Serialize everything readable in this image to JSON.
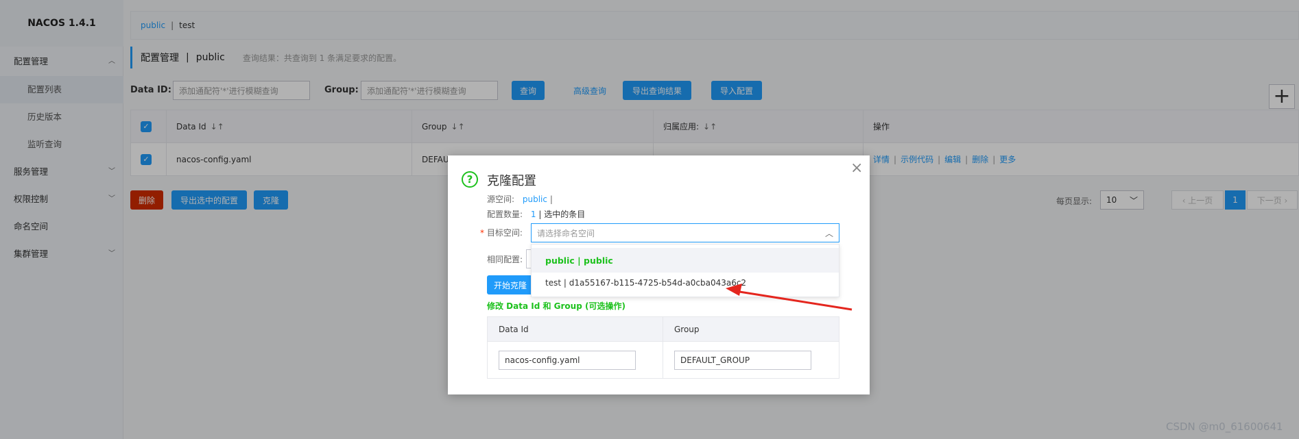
{
  "sidebar": {
    "logo": "NACOS 1.4.1",
    "items": [
      {
        "label": "配置管理",
        "chevron": "︿"
      },
      {
        "label": "配置列表"
      },
      {
        "label": "历史版本"
      },
      {
        "label": "监听查询"
      },
      {
        "label": "服务管理",
        "chevron": "﹀"
      },
      {
        "label": "权限控制",
        "chevron": "﹀"
      },
      {
        "label": "命名空间"
      },
      {
        "label": "集群管理",
        "chevron": "﹀"
      }
    ]
  },
  "namespace_tabs": {
    "public": "public",
    "separator": "|",
    "test": "test"
  },
  "page_title": {
    "section": "配置管理",
    "pipe": "|",
    "namespace": "public",
    "result": "查询结果：共查询到 1 条满足要求的配置。"
  },
  "filters": {
    "dataid_label": "Data ID:",
    "dataid_placeholder": "添加通配符'*'进行模糊查询",
    "group_label": "Group:",
    "group_placeholder": "添加通配符'*'进行模糊查询",
    "query_btn": "查询",
    "advanced_link": "高级查询",
    "export_btn": "导出查询结果",
    "import_btn": "导入配置",
    "plus": "+"
  },
  "table": {
    "check": "✓",
    "headers": [
      "Data Id",
      "Group",
      "归属应用:",
      "操作"
    ],
    "sort_icon": "↓↑",
    "row": {
      "dataid": "nacos-config.yaml",
      "group": "DEFAU"
    },
    "ops": [
      "详情",
      "示例代码",
      "编辑",
      "删除",
      "更多"
    ],
    "ops_sep": "|"
  },
  "bottom_actions": {
    "delete": "删除",
    "export_selected": "导出选中的配置",
    "clone": "克隆"
  },
  "pagination": {
    "per_page_label": "每页显示:",
    "per_page": "10",
    "prev": "‹ 上一页",
    "current": "1",
    "next": "下一页 ›",
    "chevron": "﹀"
  },
  "dialog": {
    "icon": "?",
    "title": "克隆配置",
    "close": "×",
    "source_label": "源空间:",
    "source_value": "public",
    "source_sep": "|",
    "count_label": "配置数量:",
    "count_value": "1",
    "count_suffix": "| 选中的条目",
    "req_mark": "*",
    "target_label": "目标空间:",
    "target_placeholder": "请选择命名空间",
    "dd_chevron": "︿",
    "options": [
      "public | public",
      "test | d1a55167-b115-4725-b54d-a0cba043a6c2"
    ],
    "same_config_label": "相同配置:",
    "start_btn": "开始克隆",
    "modify_title": "修改 Data Id 和 Group (可选操作)",
    "inner_headers": [
      "Data Id",
      "Group"
    ],
    "inner_values": [
      "nacos-config.yaml",
      "DEFAULT_GROUP"
    ]
  },
  "watermark": "CSDN @m0_61600641",
  "colors": {
    "primary": "#209bfa",
    "danger": "#d22c00",
    "success": "#1dc11d",
    "arrow": "#e4261e"
  }
}
